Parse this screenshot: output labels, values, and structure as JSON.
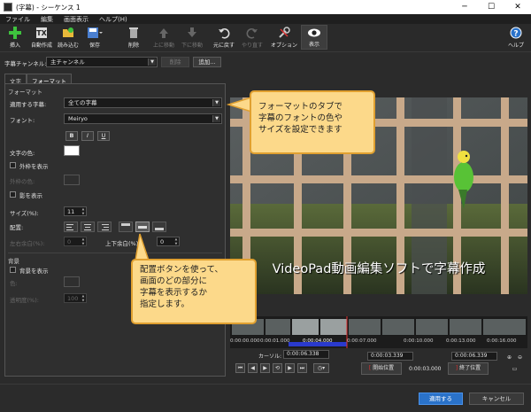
{
  "window": {
    "title": "(字幕) - シーケンス 1",
    "minimize": "─",
    "maximize": "☐",
    "close": "✕"
  },
  "menu": [
    "ファイル",
    "編集",
    "画面表示",
    "ヘルプ(H)"
  ],
  "toolbar": {
    "items": [
      {
        "label": "挿入",
        "icon": "plus-icon"
      },
      {
        "label": "自動作成",
        "icon": "auto-create-icon"
      },
      {
        "label": "読み込む",
        "icon": "folder-icon"
      },
      {
        "label": "保存",
        "icon": "save-icon"
      },
      {
        "label": "削除",
        "icon": "trash-icon"
      },
      {
        "label": "上に移動",
        "icon": "move-up-icon"
      },
      {
        "label": "下に移動",
        "icon": "move-down-icon"
      },
      {
        "label": "元に戻す",
        "icon": "undo-icon"
      },
      {
        "label": "やり直す",
        "icon": "redo-icon"
      },
      {
        "label": "オプション",
        "icon": "options-icon"
      },
      {
        "label": "表示",
        "icon": "eye-icon"
      }
    ],
    "help_label": "ヘルプ"
  },
  "channel": {
    "label": "字幕チャンネル:",
    "value": "主チャンネル",
    "delete_label": "削除",
    "add_label": "追加..."
  },
  "tabs": [
    "文字",
    "フォーマット"
  ],
  "format": {
    "group_label": "フォーマット",
    "apply_label": "適用する字幕:",
    "apply_value": "全ての字幕",
    "font_label": "フォント:",
    "font_value": "Meiryo",
    "bold": "B",
    "italic": "I",
    "underline": "U",
    "text_color_label": "文字の色:",
    "outline_label": "外枠を表示",
    "outline_color_label": "外枠の色:",
    "shadow_label": "影を表示",
    "size_label": "サイズ(%):",
    "size_value": "11",
    "position_label": "配置:",
    "hmargin_label": "左右余白(%):",
    "hmargin_value": "0",
    "vmargin_label": "上下余白(%):",
    "vmargin_value": "0"
  },
  "background": {
    "group_label": "背景",
    "show_label": "背景を表示",
    "color_label": "色:",
    "opacity_label": "透明度(%):",
    "opacity_value": "100"
  },
  "preview": {
    "subtitle": "VideoPad動画編集ソフトで字幕作成"
  },
  "timeline": {
    "ticks": [
      "0:00:00.000",
      "0:00:01.000",
      "0:00:04.000",
      "0:00:07.000",
      "0:00:10.000",
      "0:00:13.000",
      "0:00:16.000"
    ]
  },
  "transport": {
    "cursor_label": "カーソル:",
    "cursor_value": "0:00:06.338",
    "start_value": "0:00:03.339",
    "start_label": "開始位置",
    "duration_value": "0:00:03.000",
    "end_value": "0:00:06.339",
    "end_label": "終了位置"
  },
  "footer": {
    "apply_label": "適用する",
    "cancel_label": "キャンセル"
  },
  "callouts": {
    "top": [
      "フォーマットのタブで",
      "字幕のフォントの色や",
      "サイズを設定できます"
    ],
    "bottom": [
      "配置ボタンを使って、",
      "画面のどの部分に",
      "字幕を表示するか",
      "指定します。"
    ]
  },
  "colors": {
    "accent": "#2a72c9",
    "callout_bg": "#fcd98a",
    "callout_border": "#e0a030",
    "text_color": "#ffffff"
  }
}
